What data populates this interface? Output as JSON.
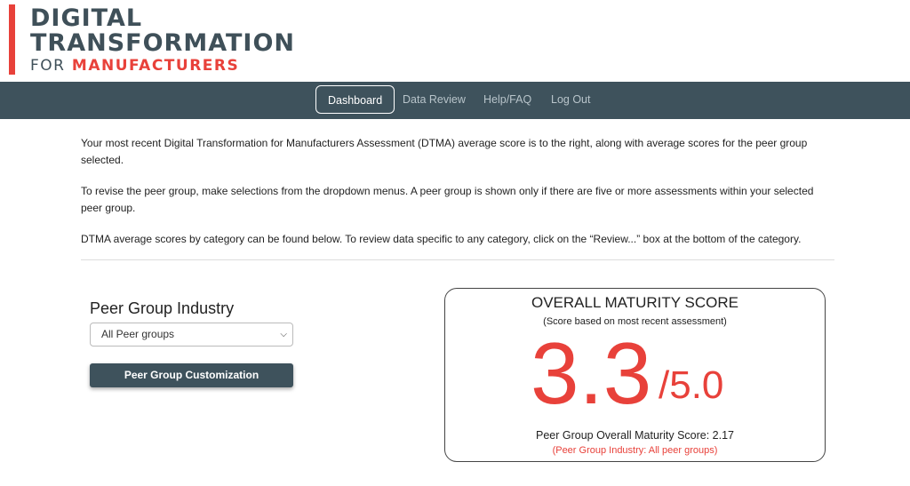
{
  "logo": {
    "line1": "DIGITAL",
    "line2": "TRANSFORMATION",
    "line3_for": "FOR",
    "line3_mfg": "MANUFACTURERS"
  },
  "nav": {
    "items": [
      "Dashboard",
      "Data Review",
      "Help/FAQ",
      "Log Out"
    ],
    "active": "Dashboard"
  },
  "intro": {
    "p1": "Your most recent Digital Transformation for Manufacturers Assessment (DTMA) average score is to the right, along with average scores for the peer group selected.",
    "p2": "To revise the peer group, make selections from the dropdown menus. A peer group is shown only if there are five or more assessments within your selected peer group.",
    "p3": "DTMA average scores by category can be found below. To review data specific to any category, click on the “Review...” box at the bottom of the category."
  },
  "peer_group": {
    "label": "Peer Group Industry",
    "selected": "All Peer groups",
    "button": "Peer Group Customization"
  },
  "score": {
    "title": "OVERALL MATURITY SCORE",
    "subtitle": "(Score based on most recent assessment)",
    "value": "3.3",
    "max": "/5.0",
    "peer_line": "Peer Group Overall Maturity Score: 2.17",
    "peer_industry": "(Peer Group Industry: All peer groups)"
  },
  "colors": {
    "accent": "#e8413a",
    "nav_bg": "#3e525c",
    "logo_text": "#3f5059"
  }
}
